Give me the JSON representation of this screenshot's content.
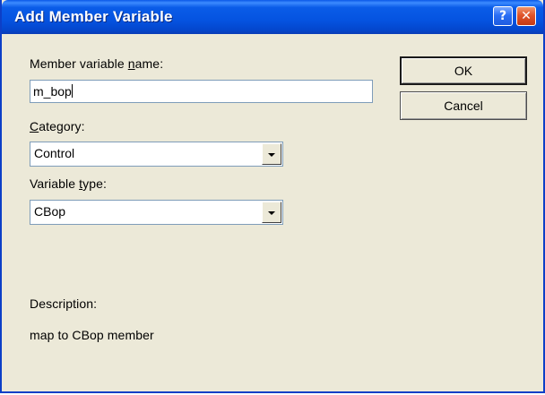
{
  "window": {
    "title": "Add Member Variable"
  },
  "titlebar_buttons": {
    "help_glyph": "?",
    "close_glyph": "✕"
  },
  "fields": {
    "member_name_label_prefix": "Member variable ",
    "member_name_label_accel": "n",
    "member_name_label_suffix": "ame:",
    "member_name_value": "m_bop",
    "category_label_accel": "C",
    "category_label_suffix": "ategory:",
    "category_value": "Control",
    "variable_type_label_prefix": "Variable ",
    "variable_type_label_accel": "t",
    "variable_type_label_suffix": "ype:",
    "variable_type_value": "CBop"
  },
  "description": {
    "label": "Description:",
    "text": "map to CBop member"
  },
  "buttons": {
    "ok": "OK",
    "cancel": "Cancel"
  }
}
